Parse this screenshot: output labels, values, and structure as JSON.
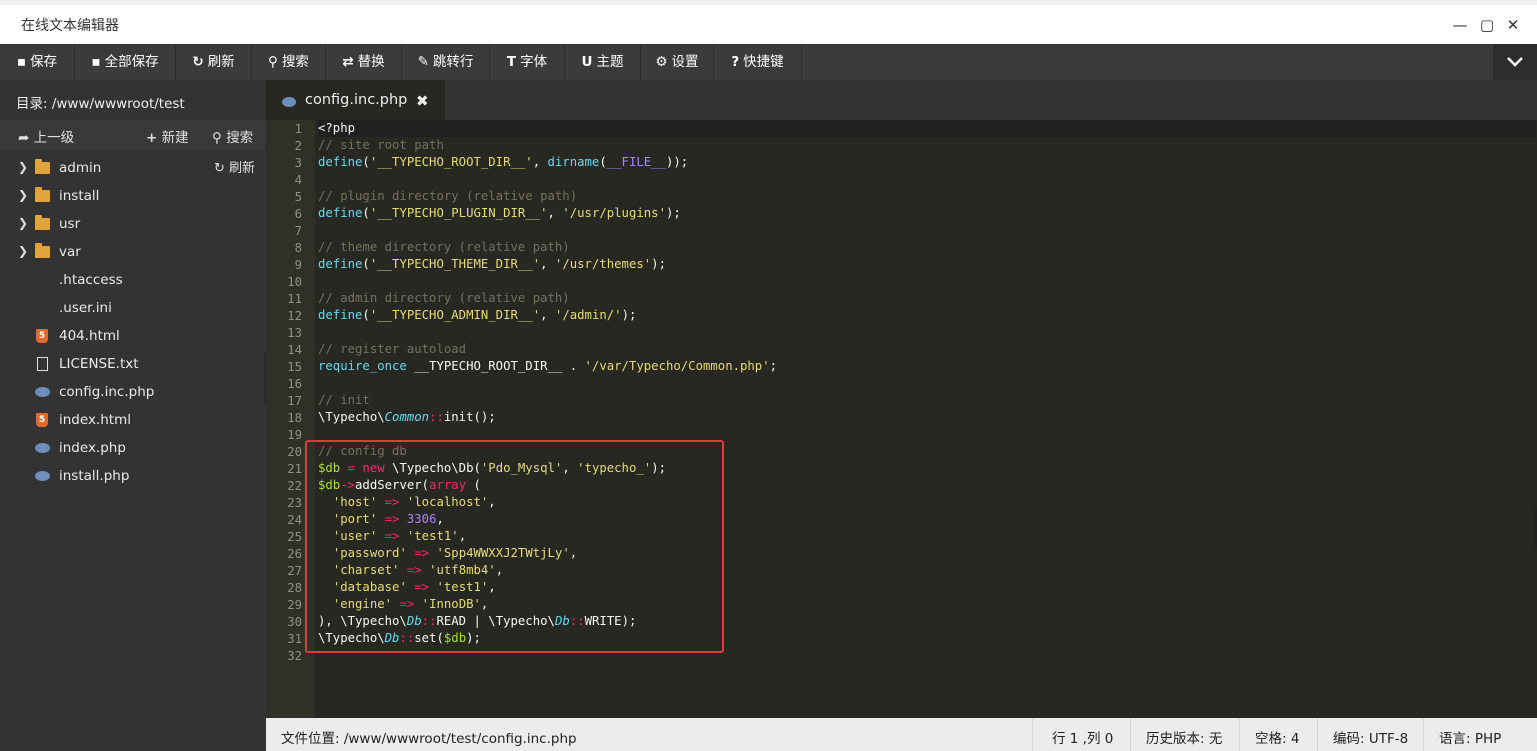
{
  "window": {
    "title": "在线文本编辑器"
  },
  "toolbar": [
    {
      "icon": "save-icon",
      "glyph": "▪",
      "label": "保存"
    },
    {
      "icon": "save-all-icon",
      "glyph": "▪",
      "label": "全部保存"
    },
    {
      "icon": "refresh-icon",
      "glyph": "↻",
      "label": "刷新"
    },
    {
      "icon": "search-icon",
      "glyph": "⚲",
      "label": "搜索"
    },
    {
      "icon": "replace-icon",
      "glyph": "⇄",
      "label": "替换"
    },
    {
      "icon": "pin-icon",
      "glyph": "✎",
      "label": "跳转行"
    },
    {
      "icon": "font-icon",
      "glyph": "T",
      "label": "字体"
    },
    {
      "icon": "magnet-icon",
      "glyph": "U",
      "label": "主题"
    },
    {
      "icon": "gear-icon",
      "glyph": "⚙",
      "label": "设置"
    },
    {
      "icon": "question-icon",
      "glyph": "?",
      "label": "快捷键"
    }
  ],
  "sidebar": {
    "dir_label": "目录: /www/wwwroot/test",
    "up_label": "上一级",
    "new_label": "新建",
    "search_label": "搜索",
    "refresh_label": "刷新",
    "items": [
      {
        "name": "admin",
        "type": "folder"
      },
      {
        "name": "install",
        "type": "folder"
      },
      {
        "name": "usr",
        "type": "folder"
      },
      {
        "name": "var",
        "type": "folder"
      },
      {
        "name": ".htaccess",
        "type": "plain"
      },
      {
        "name": ".user.ini",
        "type": "plain"
      },
      {
        "name": "404.html",
        "type": "html"
      },
      {
        "name": "LICENSE.txt",
        "type": "text"
      },
      {
        "name": "config.inc.php",
        "type": "php"
      },
      {
        "name": "index.html",
        "type": "html"
      },
      {
        "name": "index.php",
        "type": "php"
      },
      {
        "name": "install.php",
        "type": "php"
      }
    ]
  },
  "editor": {
    "tab_label": "config.inc.php",
    "close_glyph": "✖",
    "lines": [
      [
        [
          "p",
          "<?php"
        ]
      ],
      [
        [
          "c",
          "// site root path"
        ]
      ],
      [
        [
          "f",
          "define"
        ],
        [
          "p",
          "("
        ],
        [
          "s",
          "'__TYPECHO_ROOT_DIR__'"
        ],
        [
          "p",
          ", "
        ],
        [
          "f",
          "dirname"
        ],
        [
          "p",
          "("
        ],
        [
          "n",
          "__FILE__"
        ],
        [
          "p",
          "));"
        ]
      ],
      [],
      [
        [
          "c",
          "// plugin directory (relative path)"
        ]
      ],
      [
        [
          "f",
          "define"
        ],
        [
          "p",
          "("
        ],
        [
          "s",
          "'__TYPECHO_PLUGIN_DIR__'"
        ],
        [
          "p",
          ", "
        ],
        [
          "s",
          "'/usr/plugins'"
        ],
        [
          "p",
          ");"
        ]
      ],
      [],
      [
        [
          "c",
          "// theme directory (relative path)"
        ]
      ],
      [
        [
          "f",
          "define"
        ],
        [
          "p",
          "("
        ],
        [
          "s",
          "'__TYPECHO_THEME_DIR__'"
        ],
        [
          "p",
          ", "
        ],
        [
          "s",
          "'/usr/themes'"
        ],
        [
          "p",
          ");"
        ]
      ],
      [],
      [
        [
          "c",
          "// admin directory (relative path)"
        ]
      ],
      [
        [
          "f",
          "define"
        ],
        [
          "p",
          "("
        ],
        [
          "s",
          "'__TYPECHO_ADMIN_DIR__'"
        ],
        [
          "p",
          ", "
        ],
        [
          "s",
          "'/admin/'"
        ],
        [
          "p",
          ");"
        ]
      ],
      [],
      [
        [
          "c",
          "// register autoload"
        ]
      ],
      [
        [
          "f",
          "require_once"
        ],
        [
          "p",
          " __TYPECHO_ROOT_DIR__ . "
        ],
        [
          "s",
          "'/var/Typecho/Common.php'"
        ],
        [
          "p",
          ";"
        ]
      ],
      [],
      [
        [
          "c",
          "// init"
        ]
      ],
      [
        [
          "p",
          "\\Typecho\\"
        ],
        [
          "i",
          "Common"
        ],
        [
          "k",
          "::"
        ],
        [
          "p",
          "init();"
        ]
      ],
      [],
      [
        [
          "c",
          "// config db"
        ]
      ],
      [
        [
          "v",
          "$db"
        ],
        [
          "k",
          " = new "
        ],
        [
          "p",
          "\\Typecho\\Db("
        ],
        [
          "s",
          "'Pdo_Mysql'"
        ],
        [
          "p",
          ", "
        ],
        [
          "s",
          "'typecho_'"
        ],
        [
          "p",
          ");"
        ]
      ],
      [
        [
          "v",
          "$db"
        ],
        [
          "k",
          "->"
        ],
        [
          "p",
          "addServer("
        ],
        [
          "k",
          "array"
        ],
        [
          "p",
          " ("
        ]
      ],
      [
        [
          "p",
          "  "
        ],
        [
          "s",
          "'host'"
        ],
        [
          "k",
          " => "
        ],
        [
          "s",
          "'localhost'"
        ],
        [
          "p",
          ","
        ]
      ],
      [
        [
          "p",
          "  "
        ],
        [
          "s",
          "'port'"
        ],
        [
          "k",
          " => "
        ],
        [
          "n",
          "3306"
        ],
        [
          "p",
          ","
        ]
      ],
      [
        [
          "p",
          "  "
        ],
        [
          "s",
          "'user'"
        ],
        [
          "k",
          " => "
        ],
        [
          "s",
          "'test1'"
        ],
        [
          "p",
          ","
        ]
      ],
      [
        [
          "p",
          "  "
        ],
        [
          "s",
          "'password'"
        ],
        [
          "k",
          " => "
        ],
        [
          "s",
          "'Spp4WWXXJ2TWtjLy'"
        ],
        [
          "p",
          ","
        ]
      ],
      [
        [
          "p",
          "  "
        ],
        [
          "s",
          "'charset'"
        ],
        [
          "k",
          " => "
        ],
        [
          "s",
          "'utf8mb4'"
        ],
        [
          "p",
          ","
        ]
      ],
      [
        [
          "p",
          "  "
        ],
        [
          "s",
          "'database'"
        ],
        [
          "k",
          " => "
        ],
        [
          "s",
          "'test1'"
        ],
        [
          "p",
          ","
        ]
      ],
      [
        [
          "p",
          "  "
        ],
        [
          "s",
          "'engine'"
        ],
        [
          "k",
          " => "
        ],
        [
          "s",
          "'InnoDB'"
        ],
        [
          "p",
          ","
        ]
      ],
      [
        [
          "p",
          "), \\Typecho\\"
        ],
        [
          "i",
          "Db"
        ],
        [
          "k",
          "::"
        ],
        [
          "p",
          "READ | \\Typecho\\"
        ],
        [
          "i",
          "Db"
        ],
        [
          "k",
          "::"
        ],
        [
          "p",
          "WRITE);"
        ]
      ],
      [
        [
          "p",
          "\\Typecho\\"
        ],
        [
          "i",
          "Db"
        ],
        [
          "k",
          "::"
        ],
        [
          "p",
          "set("
        ],
        [
          "v",
          "$db"
        ],
        [
          "p",
          ");"
        ]
      ],
      []
    ]
  },
  "status": {
    "file_path": "文件位置: /www/wwwroot/test/config.inc.php",
    "cursor": "行 1 ,列 0",
    "history": "历史版本: 无",
    "indent": "空格: 4",
    "encoding": "编码: UTF-8",
    "language": "语言: PHP"
  }
}
